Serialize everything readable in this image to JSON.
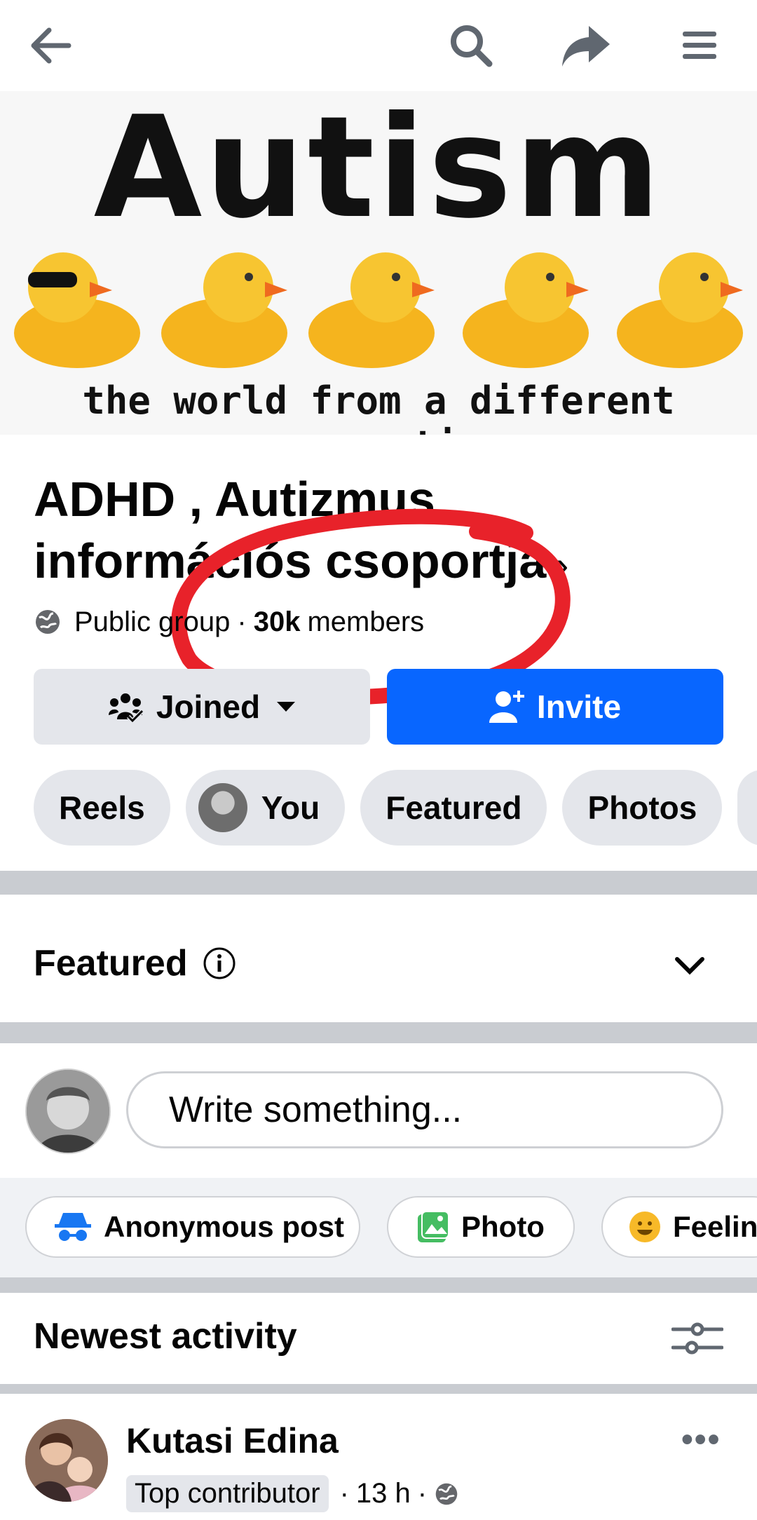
{
  "header": {
    "back_icon": "back-arrow-icon",
    "search_icon": "search-icon",
    "share_icon": "share-icon",
    "menu_icon": "menu-icon"
  },
  "cover": {
    "title": "Autism",
    "tagline": "the world from a different perspective",
    "duck_color": "#f5c518"
  },
  "group": {
    "name": "ADHD , Autizmus információs csoportja",
    "chevron": "›",
    "privacy": "Public group",
    "separator": "·",
    "members_count": "30k",
    "members_label": "members"
  },
  "actions": {
    "joined_label": "Joined",
    "invite_label": "Invite",
    "accent": "#0866ff"
  },
  "tabs": [
    {
      "label": "Reels"
    },
    {
      "label": "You"
    },
    {
      "label": "Featured"
    },
    {
      "label": "Photos"
    }
  ],
  "featured": {
    "title": "Featured"
  },
  "composer": {
    "placeholder": "Write something..."
  },
  "post_types": [
    {
      "label": "Anonymous post",
      "icon": "incognito-icon",
      "color": "#1877f2"
    },
    {
      "label": "Photo",
      "icon": "photo-icon",
      "color": "#45bd62"
    },
    {
      "label": "Feelin",
      "icon": "smiley-icon",
      "color": "#f7b928"
    }
  ],
  "newest": {
    "title": "Newest activity"
  },
  "post": {
    "author": "Kutasi Edina",
    "badge": "Top contributor",
    "time": "13 h",
    "dot": "·",
    "more": "•••"
  }
}
